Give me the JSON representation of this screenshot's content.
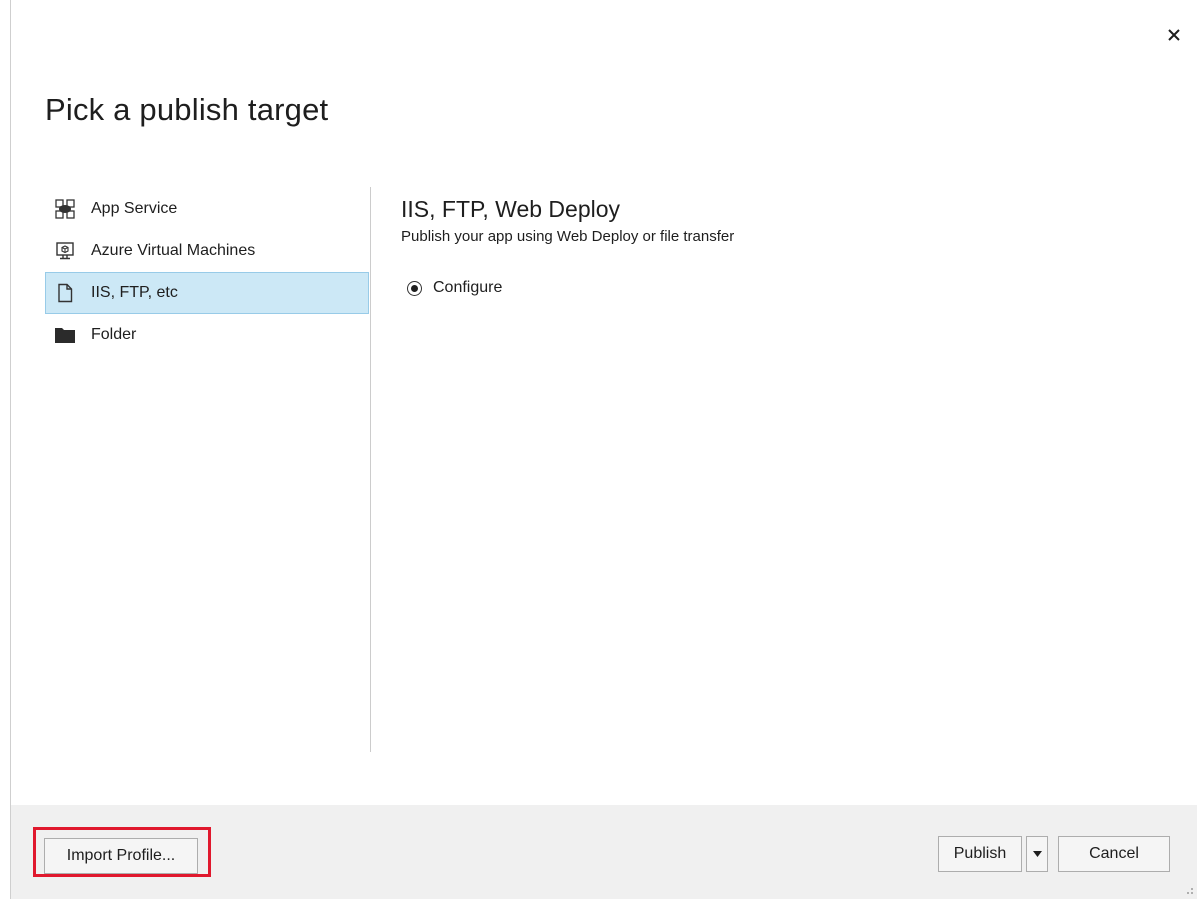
{
  "dialog": {
    "title": "Pick a publish target",
    "close_icon": "close-icon"
  },
  "targets": [
    {
      "label": "App Service",
      "icon": "app-service-icon",
      "selected": false
    },
    {
      "label": "Azure Virtual Machines",
      "icon": "virtual-machine-icon",
      "selected": false
    },
    {
      "label": "IIS, FTP, etc",
      "icon": "document-icon",
      "selected": true
    },
    {
      "label": "Folder",
      "icon": "folder-icon",
      "selected": false
    }
  ],
  "detail": {
    "title": "IIS, FTP, Web Deploy",
    "description": "Publish your app using Web Deploy or file transfer",
    "option_label": "Configure",
    "option_selected": true
  },
  "footer": {
    "import_label": "Import Profile...",
    "publish_label": "Publish",
    "cancel_label": "Cancel",
    "highlight_color": "#e0182d"
  },
  "colors": {
    "selection_bg": "#cce8f6",
    "selection_border": "#98cbe8",
    "footer_bg": "#f0f0f0"
  }
}
